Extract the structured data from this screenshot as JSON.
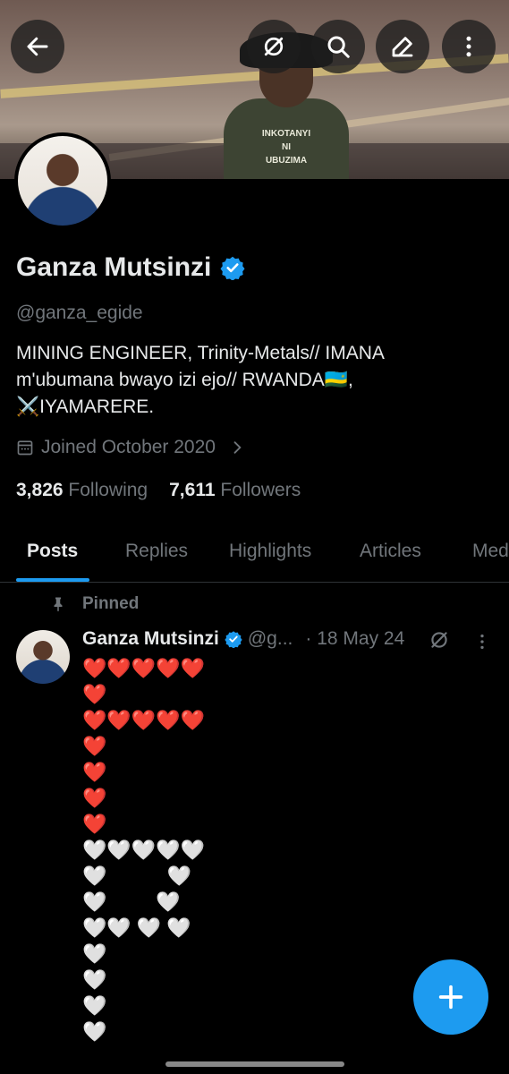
{
  "banner": {
    "shirt_text": "INKOTANYI\nNI\nUBUZIMA"
  },
  "header_buttons": [
    {
      "icon": "back-arrow-icon"
    },
    {
      "icon": "grok-icon"
    },
    {
      "icon": "search-icon"
    },
    {
      "icon": "edit-icon"
    },
    {
      "icon": "more-vertical-icon"
    }
  ],
  "profile": {
    "name": "Ganza Mutsinzi",
    "handle": "@ganza_egide",
    "bio": "MINING ENGINEER,  Trinity-Metals// IMANA\nm'ubumana bwayo izi ejo// RWANDA🇷🇼,\n⚔️IYAMARERE.",
    "joined": "Joined October 2020",
    "following_count": "3,826",
    "following_label": "Following",
    "followers_count": "7,611",
    "followers_label": "Followers"
  },
  "tabs": [
    {
      "label": "Posts",
      "active": true
    },
    {
      "label": "Replies"
    },
    {
      "label": "Highlights"
    },
    {
      "label": "Articles"
    },
    {
      "label": "Media"
    }
  ],
  "post": {
    "pinned_label": "Pinned",
    "author_name": "Ganza Mutsinzi",
    "author_handle": "@g...",
    "date": "· 18 May 24",
    "body": "❤️❤️❤️❤️❤️\n❤️\n❤️❤️❤️❤️❤️\n❤️\n❤️\n❤️\n❤️\n🤍🤍🤍🤍🤍\n🤍           🤍\n🤍         🤍\n🤍🤍 🤍 🤍\n🤍\n🤍\n🤍\n🤍"
  },
  "colors": {
    "accent": "#1d9bf0",
    "background": "#000000",
    "text_primary": "#e7e9ea",
    "text_secondary": "#71767b"
  },
  "fab_icon": "plus-icon"
}
